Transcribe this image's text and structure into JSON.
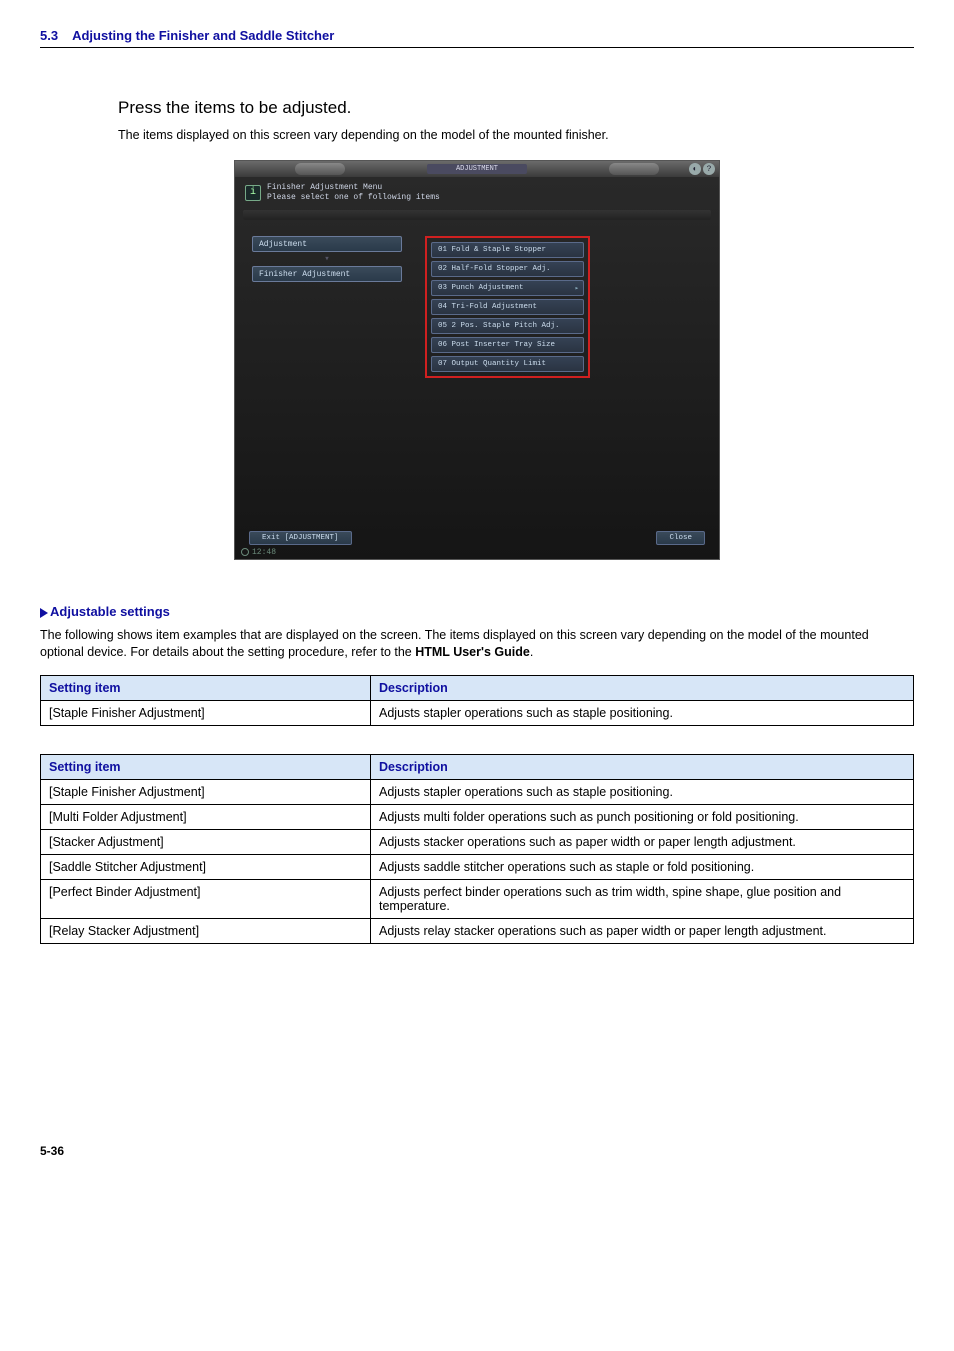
{
  "header": {
    "section_number": "5.3",
    "section_title": "Adjusting the Finisher and Saddle Stitcher"
  },
  "intro": {
    "heading": "Press the items to be adjusted.",
    "note": "The items displayed on this screen vary depending on the model of the mounted finisher."
  },
  "screenshot": {
    "titlebar": "ADJUSTMENT",
    "info_line1": "Finisher Adjustment Menu",
    "info_line2": "Please select one of following items",
    "left_nav": {
      "item1": "Adjustment",
      "item2": "Finisher Adjustment"
    },
    "menu_items": [
      "01 Fold & Staple Stopper",
      "02 Half-Fold Stopper Adj.",
      "03 Punch Adjustment",
      "04 Tri-Fold Adjustment",
      "05 2 Pos. Staple Pitch Adj.",
      "06 Post Inserter Tray Size",
      "07 Output Quantity Limit"
    ],
    "footer_left": "Exit [ADJUSTMENT]",
    "footer_right": "Close",
    "clock": "12:48"
  },
  "adjustable": {
    "heading": "Adjustable settings",
    "para_part1": "The following shows item examples that are displayed on the screen. The items displayed on this screen vary depending on the model of the mounted optional device. For details about the setting procedure, refer to the ",
    "para_bold": "HTML User's Guide",
    "para_part2": "."
  },
  "table1": {
    "h1": "Setting item",
    "h2": "Description",
    "rows": [
      {
        "item": "[Staple Finisher Adjustment]",
        "desc": "Adjusts stapler operations such as staple positioning."
      }
    ]
  },
  "table2": {
    "h1": "Setting item",
    "h2": "Description",
    "rows": [
      {
        "item": "[Staple Finisher Adjustment]",
        "desc": "Adjusts stapler operations such as staple positioning."
      },
      {
        "item": "[Multi Folder Adjustment]",
        "desc": "Adjusts multi folder operations such as punch positioning or fold positioning."
      },
      {
        "item": "[Stacker Adjustment]",
        "desc": "Adjusts stacker operations such as paper width or paper length adjustment."
      },
      {
        "item": "[Saddle Stitcher Adjustment]",
        "desc": "Adjusts saddle stitcher operations such as staple or fold positioning."
      },
      {
        "item": "[Perfect Binder Adjustment]",
        "desc": "Adjusts perfect binder operations such as trim width, spine shape, glue position and temperature."
      },
      {
        "item": "[Relay Stacker Adjustment]",
        "desc": "Adjusts relay stacker operations such as paper width or paper length adjustment."
      }
    ]
  },
  "page_number": "5-36"
}
